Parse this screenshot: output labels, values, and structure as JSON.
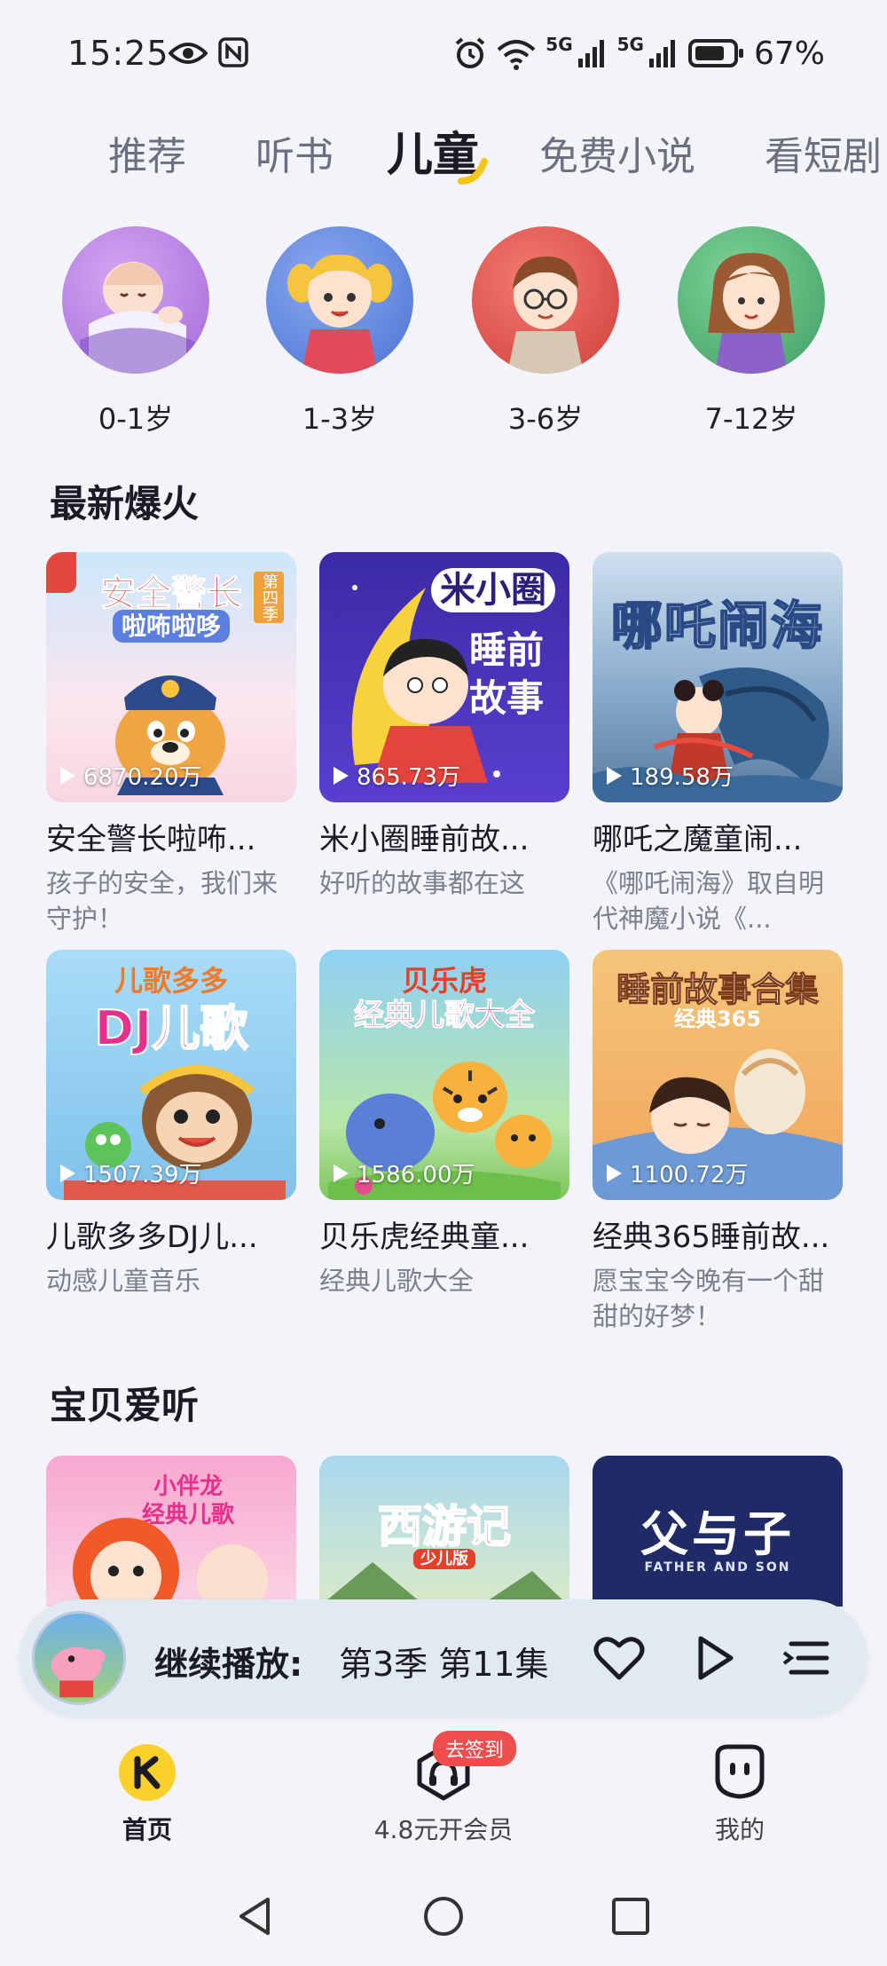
{
  "status": {
    "time": "15:25",
    "network1": "5G",
    "network2": "5G",
    "battery": "67%"
  },
  "tabs": [
    {
      "label": "推荐"
    },
    {
      "label": "听书"
    },
    {
      "label": "儿童"
    },
    {
      "label": "免费小说"
    },
    {
      "label": "看短剧"
    }
  ],
  "active_tab": "儿童",
  "ages": [
    {
      "label": "0-1岁",
      "color": "#b67ee6"
    },
    {
      "label": "1-3岁",
      "color": "#5b86e0"
    },
    {
      "label": "3-6岁",
      "color": "#e05a52"
    },
    {
      "label": "7-12岁",
      "color": "#58b878"
    }
  ],
  "section1": {
    "title": "最新爆火",
    "items": [
      {
        "title": "安全警长啦咘...",
        "desc": "孩子的安全，我们来守护！",
        "plays": "6870.20万",
        "cover_title": "安全警长",
        "cover_sub": "啦咘啦哆",
        "cover_badge": "第四季"
      },
      {
        "title": "米小圈睡前故...",
        "desc": "好听的故事都在这",
        "plays": "865.73万",
        "cover_title": "米小圈",
        "cover_sub": "睡前故事"
      },
      {
        "title": "哪吒之魔童闹...",
        "desc": "《哪吒闹海》取自明代神魔小说《...",
        "plays": "189.58万",
        "cover_title": "哪吒闹海"
      },
      {
        "title": "儿歌多多DJ儿...",
        "desc": "动感儿童音乐",
        "plays": "1507.39万",
        "cover_title": "儿歌多多",
        "cover_sub": "DJ儿歌"
      },
      {
        "title": "贝乐虎经典童...",
        "desc": "经典儿歌大全",
        "plays": "1586.00万",
        "cover_title": "贝乐虎",
        "cover_sub": "经典儿歌大全"
      },
      {
        "title": "经典365睡前故...",
        "desc": "愿宝宝今晚有一个甜甜的好梦！",
        "plays": "1100.72万",
        "cover_title": "睡前故事合集",
        "cover_sub": "经典365"
      }
    ]
  },
  "section2": {
    "title": "宝贝爱听",
    "items": [
      {
        "cover_title": "小伴龙",
        "cover_sub": "经典儿歌"
      },
      {
        "cover_title": "西游记",
        "cover_sub": "少儿版"
      },
      {
        "cover_title": "父与子",
        "cover_sub": "FATHER AND SON"
      }
    ]
  },
  "player": {
    "label": "继续播放:",
    "episode": "第3季 第11集"
  },
  "nav": [
    {
      "label": "首页"
    },
    {
      "label": "4.8元开会员"
    },
    {
      "label": "我的"
    }
  ],
  "nav_badge": "去签到",
  "colors": {
    "accent": "#f7c519",
    "badge": "#ef4d4d"
  }
}
